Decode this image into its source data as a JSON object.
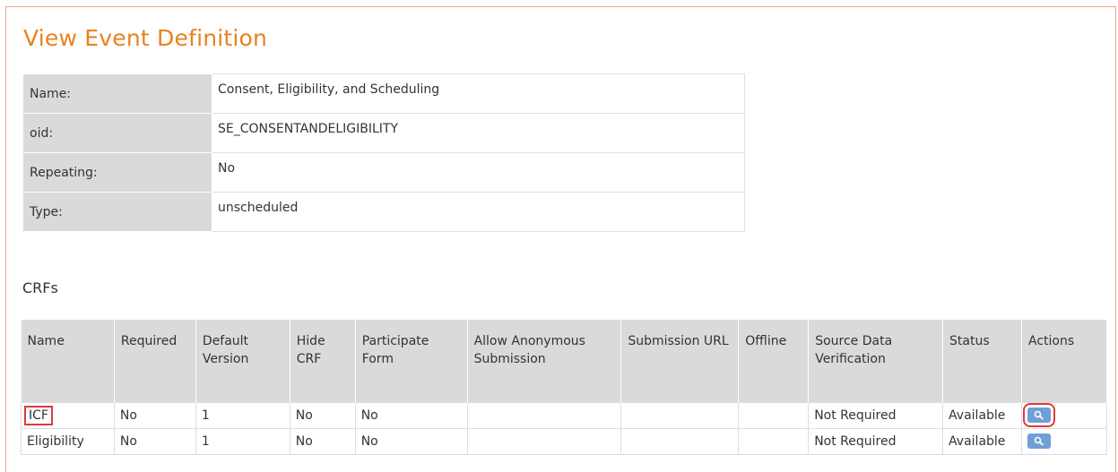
{
  "page": {
    "title": "View Event Definition"
  },
  "definition": {
    "rows": [
      {
        "label": "Name:",
        "value": "Consent, Eligibility, and Scheduling"
      },
      {
        "label": "oid:",
        "value": "SE_CONSENTANDELIGIBILITY"
      },
      {
        "label": "Repeating:",
        "value": "No"
      },
      {
        "label": "Type:",
        "value": "unscheduled"
      }
    ]
  },
  "crfs": {
    "title": "CRFs",
    "headers": [
      "Name",
      "Required",
      "Default Version",
      "Hide CRF",
      "Participate Form",
      "Allow Anonymous Submission",
      "Submission URL",
      "Offline",
      "Source Data Verification",
      "Status",
      "Actions"
    ],
    "rows": [
      {
        "name": "ICF",
        "required": "No",
        "default_version": "1",
        "hide_crf": "No",
        "participate_form": "No",
        "allow_anonymous": "",
        "submission_url": "",
        "offline": "",
        "sdv": "Not Required",
        "status": "Available",
        "action_icon": "view-magnifier-icon"
      },
      {
        "name": "Eligibility",
        "required": "No",
        "default_version": "1",
        "hide_crf": "No",
        "participate_form": "No",
        "allow_anonymous": "",
        "submission_url": "",
        "offline": "",
        "sdv": "Not Required",
        "status": "Available",
        "action_icon": "view-magnifier-icon"
      }
    ]
  },
  "colors": {
    "title": "#e8821e",
    "label_bg": "#dadada",
    "action_button": "#6f9fd4",
    "highlight": "#e03a3a"
  }
}
